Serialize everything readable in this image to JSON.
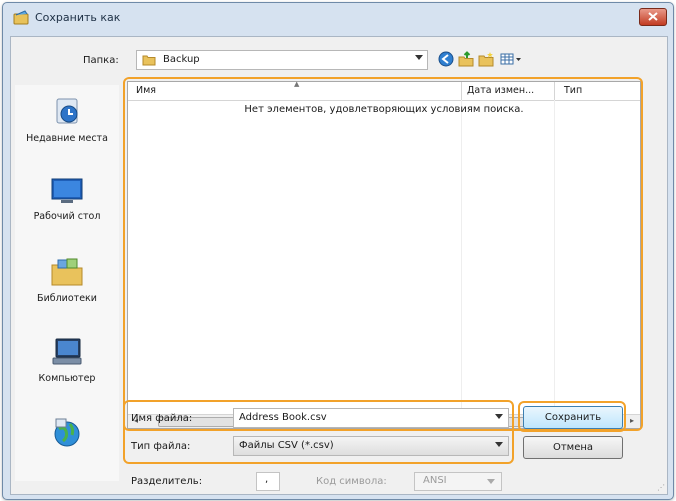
{
  "window": {
    "title": "Сохранить как"
  },
  "toolbar": {
    "folder_label": "Папка:",
    "folder_value": "Backup"
  },
  "places": [
    {
      "label": "Недавние места",
      "icon": "recent-places-icon"
    },
    {
      "label": "Рабочий стол",
      "icon": "desktop-icon"
    },
    {
      "label": "Библиотеки",
      "icon": "libraries-icon"
    },
    {
      "label": "Компьютер",
      "icon": "computer-icon"
    },
    {
      "label": "",
      "icon": "network-icon"
    }
  ],
  "file_list": {
    "columns": [
      "Имя",
      "Дата измен...",
      "Тип"
    ],
    "empty_message": "Нет элементов, удовлетворяющих условиям поиска."
  },
  "form": {
    "filename_label": "Имя файла:",
    "filename_value": "Address Book.csv",
    "filetype_label": "Тип файла:",
    "filetype_value": "Файлы CSV (*.csv)",
    "separator_label": "Разделитель:",
    "separator_value": ",",
    "encoding_label": "Код символа:",
    "encoding_value": "ANSI"
  },
  "buttons": {
    "save": "Сохранить",
    "cancel": "Отмена"
  },
  "colors": {
    "highlight": "#f2a22a",
    "title_bar": "#d6e2f0",
    "close_button": "#c23b22"
  }
}
